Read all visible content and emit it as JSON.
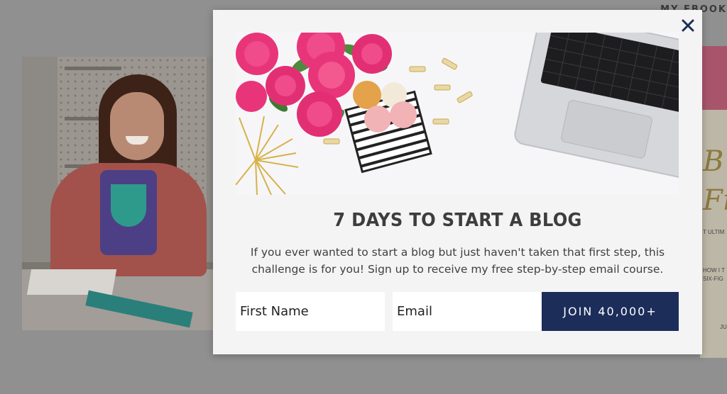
{
  "background": {
    "nav_label": "MY EBOOK",
    "ebook_cover": {
      "line1": "HOW I T",
      "line2": "SIX-FIG",
      "line3": "T ULTIM",
      "footer": "JU"
    }
  },
  "modal": {
    "close_label": "×",
    "headline": "7 DAYS TO START A BLOG",
    "description": "If you ever wanted to start a blog but just haven't taken that first step, this challenge is for you! Sign up to receive my free step-by-step email course.",
    "form": {
      "first_name_placeholder": "First Name",
      "email_placeholder": "Email",
      "submit_label": "JOIN 40,000+"
    }
  },
  "colors": {
    "overlay": "#909090",
    "modal_bg": "#f4f4f4",
    "button_bg": "#1c2d5a",
    "close_icon": "#1c2d5a",
    "headline_text": "#3d3d3d"
  },
  "icons": {
    "close": "close-icon"
  }
}
